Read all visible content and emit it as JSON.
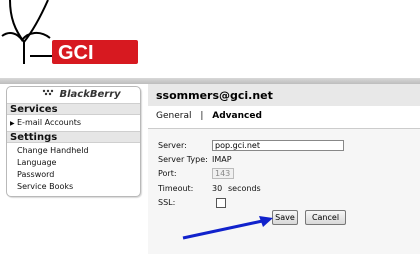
{
  "brand": {
    "logo_text": "GCI",
    "platform_name": "BlackBerry"
  },
  "sidebar": {
    "sections": [
      {
        "title": "Services",
        "items": [
          {
            "label": "E-mail Accounts"
          }
        ]
      },
      {
        "title": "Settings",
        "items": [
          {
            "label": "Change Handheld"
          },
          {
            "label": "Language"
          },
          {
            "label": "Password"
          },
          {
            "label": "Service Books"
          }
        ]
      }
    ]
  },
  "main": {
    "title": "ssommers@gci.net",
    "tabs": [
      {
        "label": "General"
      },
      {
        "label": "Advanced"
      }
    ],
    "fields": {
      "server_label": "Server:",
      "server_value": "pop.gci.net",
      "server_type_label": "Server Type:",
      "server_type_value": "IMAP",
      "port_label": "Port:",
      "port_value": "143",
      "timeout_label": "Timeout:",
      "timeout_value": "30",
      "timeout_unit": "seconds",
      "ssl_label": "SSL:"
    },
    "buttons": {
      "save": "Save",
      "cancel": "Cancel"
    }
  },
  "colors": {
    "accent_red": "#d71920",
    "annotation_blue": "#1122cc"
  }
}
